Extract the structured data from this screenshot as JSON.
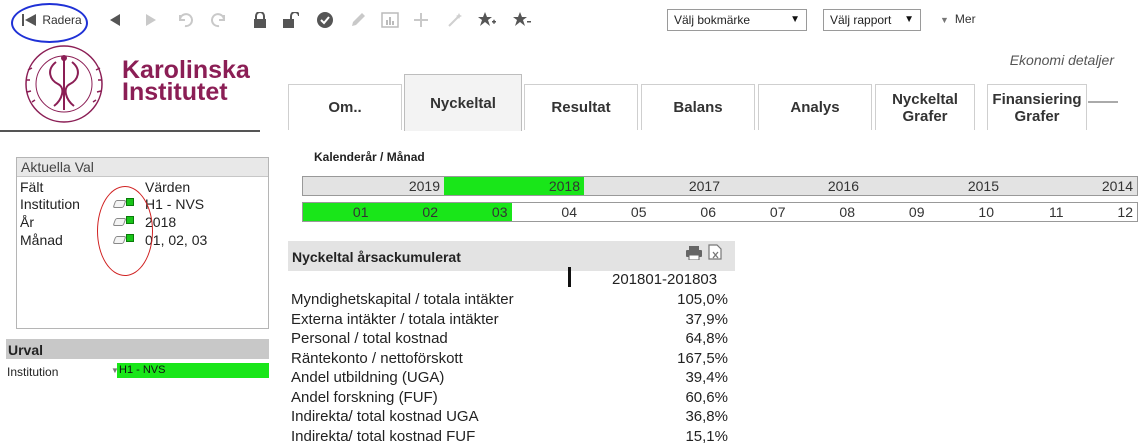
{
  "toolbar": {
    "radera_label": "Radera",
    "bookmark_select": "Välj bokmärke",
    "report_select": "Välj rapport",
    "mer_label": "Mer"
  },
  "header": {
    "logo_line1": "Karolinska",
    "logo_line2": "Institutet",
    "page_title": "Ekonomi detaljer"
  },
  "tabs": [
    {
      "label": "Om..",
      "active": false
    },
    {
      "label": "Nyckeltal",
      "active": true
    },
    {
      "label": "Resultat",
      "active": false
    },
    {
      "label": "Balans",
      "active": false
    },
    {
      "label": "Analys",
      "active": false
    },
    {
      "label": "Nyckeltal Grafer",
      "active": false
    },
    {
      "label": "Finansiering Grafer",
      "active": false
    }
  ],
  "aktuella_val": {
    "caption": "Aktuella Val",
    "col_falt": "Fält",
    "col_varden": "Värden",
    "rows": [
      {
        "field": "Institution",
        "value": "H1 - NVS"
      },
      {
        "field": "År",
        "value": "2018"
      },
      {
        "field": "Månad",
        "value": "01, 02, 03"
      }
    ]
  },
  "urval": {
    "caption": "Urval",
    "label": "Institution",
    "value": "H1 - NVS"
  },
  "kalender": {
    "title": "Kalenderår / Månad",
    "years": [
      "2019",
      "2018",
      "2017",
      "2016",
      "2015",
      "2014"
    ],
    "selected_year": "2018",
    "months": [
      "01",
      "02",
      "03",
      "04",
      "05",
      "06",
      "07",
      "08",
      "09",
      "10",
      "11",
      "12"
    ],
    "selected_months": [
      "01",
      "02",
      "03"
    ]
  },
  "nyckeltal": {
    "title": "Nyckeltal årsackumulerat",
    "column_header": "201801-201803",
    "rows": [
      {
        "label": "Myndighetskapital / totala intäkter",
        "value": "105,0%"
      },
      {
        "label": "Externa intäkter / totala intäkter",
        "value": "37,9%"
      },
      {
        "label": "Personal / total kostnad",
        "value": "64,8%"
      },
      {
        "label": "Räntekonto / nettoförskott",
        "value": "167,5%"
      },
      {
        "label": "Andel utbildning (UGA)",
        "value": "39,4%"
      },
      {
        "label": "Andel forskning (FUF)",
        "value": "60,6%"
      },
      {
        "label": "Indirekta/ total kostnad UGA",
        "value": "36,8%"
      },
      {
        "label": "Indirekta/ total kostnad FUF",
        "value": "15,1%"
      }
    ]
  },
  "colors": {
    "selected_green": "#19e619",
    "brand": "#8b1e55",
    "annotation_blue": "#1f31d6",
    "annotation_red": "#d02222"
  }
}
